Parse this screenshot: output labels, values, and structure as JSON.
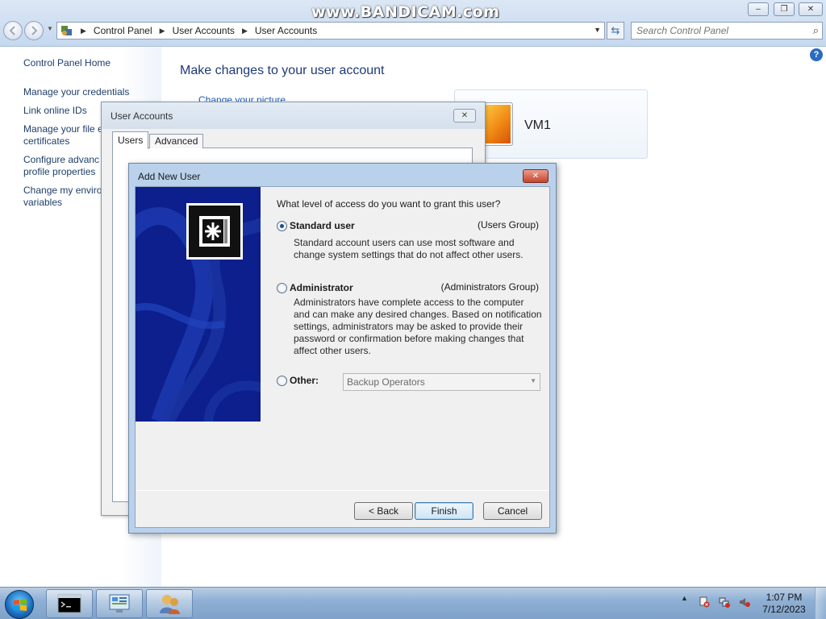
{
  "watermark": "www.BANDICAM.com",
  "explorer": {
    "breadcrumb": [
      "Control Panel",
      "User Accounts",
      "User Accounts"
    ],
    "search_placeholder": "Search Control Panel",
    "left_nav": {
      "home": "Control Panel Home",
      "items": [
        "Manage your credentials",
        "Link online IDs",
        "Manage your file e",
        "certificates",
        "Configure advanc",
        "profile properties",
        "Change my enviro",
        "variables"
      ]
    },
    "main": {
      "title": "Make changes to your user account",
      "partial_link": "Change your picture",
      "account_name": "VM1"
    }
  },
  "user_accounts_dialog": {
    "title": "User Accounts",
    "tabs": [
      "Users",
      "Advanced"
    ]
  },
  "add_new_user_dialog": {
    "title": "Add New User",
    "question": "What level of access do you want to grant this user?",
    "options": [
      {
        "label": "Standard user",
        "group": "(Users Group)",
        "selected": true,
        "description": [
          "Standard account users can use most software and",
          "change system settings that do not affect other users."
        ]
      },
      {
        "label": "Administrator",
        "group": "(Administrators Group)",
        "selected": false,
        "description": [
          "Administrators have complete access to the computer",
          "and can make any desired changes. Based on notification",
          "settings, administrators may be asked to provide their",
          "password or confirmation before making changes that",
          "affect other users."
        ]
      },
      {
        "label": "Other:",
        "selected": false,
        "select_value": "Backup Operators"
      }
    ],
    "buttons": {
      "back": "< Back",
      "finish": "Finish",
      "cancel": "Cancel"
    }
  },
  "taskbar": {
    "clock_time": "1:07 PM",
    "clock_date": "7/12/2023",
    "tray_arrow": "▲"
  },
  "icons": {
    "back": "back-arrow-icon",
    "forward": "forward-arrow-icon",
    "refresh": "refresh-icon",
    "search": "search-icon",
    "help": "help-icon",
    "wizard": "user-key-icon",
    "start": "windows-start-icon",
    "cmd": "command-prompt-icon",
    "control_panel": "control-panel-icon",
    "users": "user-accounts-icon"
  },
  "colors": {
    "link": "#1e3f6a",
    "title": "#1e3a78",
    "wizard_bg": "#0c1f8c",
    "close_red": "#c5442c"
  }
}
